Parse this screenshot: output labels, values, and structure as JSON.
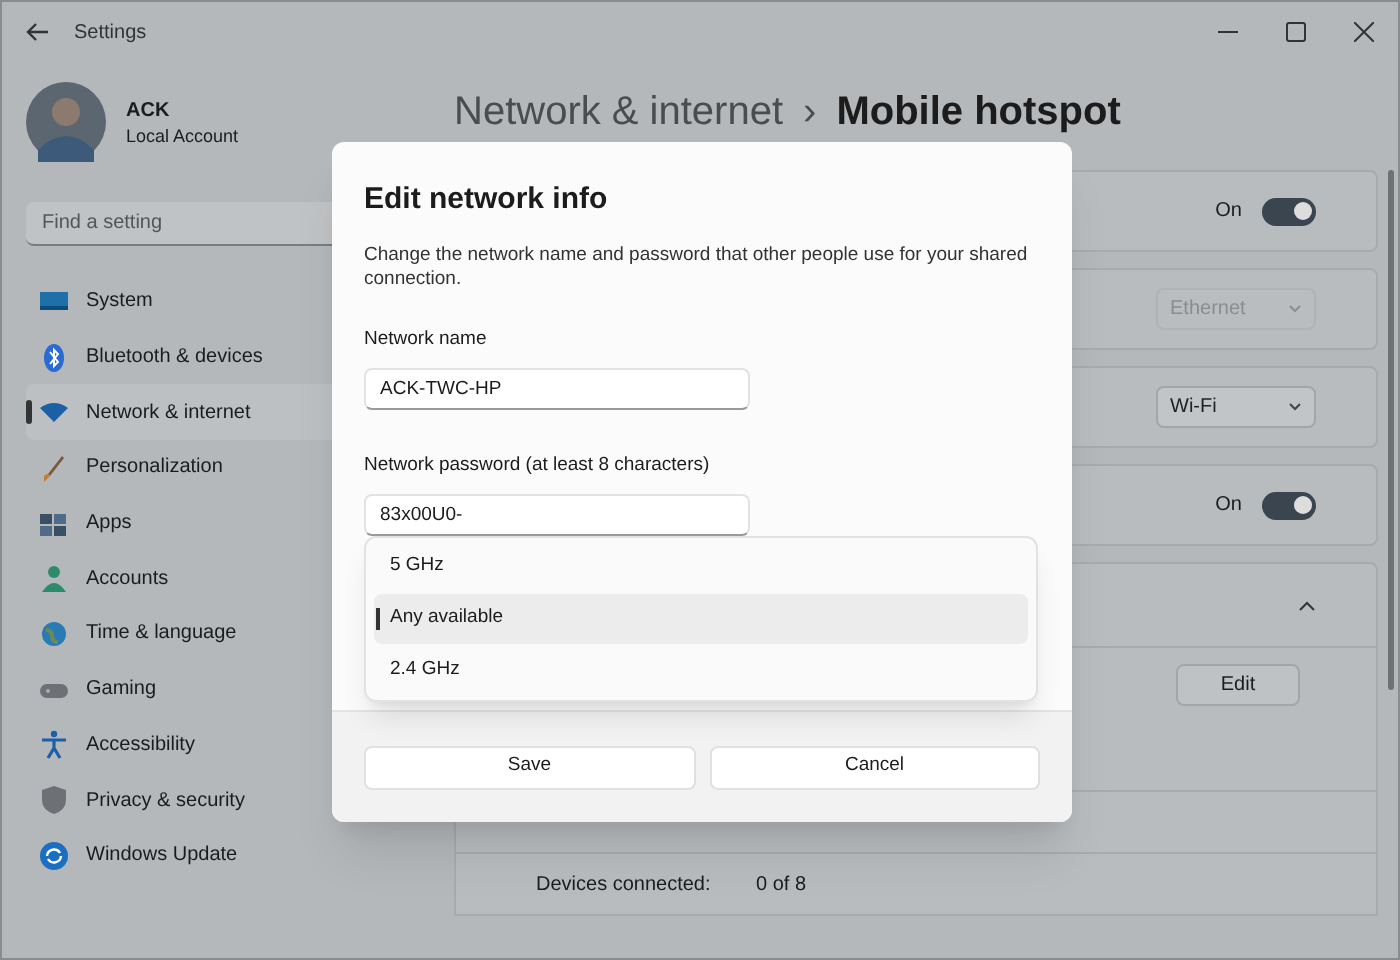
{
  "window": {
    "title": "Settings"
  },
  "account": {
    "name": "ACK",
    "type": "Local Account"
  },
  "search": {
    "placeholder": "Find a setting"
  },
  "sidebar": {
    "items": [
      {
        "label": "System",
        "selected": false
      },
      {
        "label": "Bluetooth & devices",
        "selected": false
      },
      {
        "label": "Network & internet",
        "selected": true
      },
      {
        "label": "Personalization",
        "selected": false
      },
      {
        "label": "Apps",
        "selected": false
      },
      {
        "label": "Accounts",
        "selected": false
      },
      {
        "label": "Time & language",
        "selected": false
      },
      {
        "label": "Gaming",
        "selected": false
      },
      {
        "label": "Accessibility",
        "selected": false
      },
      {
        "label": "Privacy & security",
        "selected": false
      },
      {
        "label": "Windows Update",
        "selected": false
      }
    ]
  },
  "breadcrumb": {
    "parent": "Network & internet",
    "separator": "›",
    "current": "Mobile hotspot"
  },
  "cards": [
    {
      "kind": "toggle",
      "state_label": "On",
      "on": true
    },
    {
      "kind": "dropdown",
      "value": "Ethernet",
      "disabled": true
    },
    {
      "kind": "dropdown",
      "value": "Wi-Fi",
      "disabled": false
    },
    {
      "kind": "toggle",
      "state_label": "On",
      "on": true
    },
    {
      "kind": "expander",
      "expanded": true
    }
  ],
  "properties": {
    "edit_button": "Edit",
    "rows": [
      {
        "label": "Devices connected:",
        "value": "0 of 8"
      }
    ]
  },
  "dialog": {
    "title": "Edit network info",
    "description": "Change the network name and password that other people use for your shared connection.",
    "fields": [
      {
        "label": "Network name",
        "value": "ACK-TWC-HP"
      },
      {
        "label": "Network password (at least 8 characters)",
        "value": "83x00U0-"
      }
    ],
    "band_options": [
      {
        "label": "5 GHz",
        "selected": false
      },
      {
        "label": "Any available",
        "selected": true
      },
      {
        "label": "2.4 GHz",
        "selected": false
      }
    ],
    "buttons": [
      "Save",
      "Cancel"
    ]
  }
}
